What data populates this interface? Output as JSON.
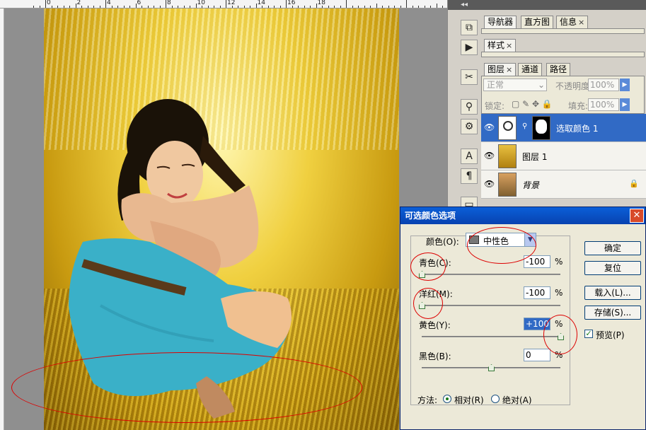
{
  "ruler": {
    "labels": [
      "0",
      "2",
      "4",
      "6",
      "8",
      "10",
      "12",
      "14",
      "16",
      "18"
    ]
  },
  "panels": {
    "tabs_row1": [
      {
        "label": "导航器",
        "close": ""
      },
      {
        "label": "直方图",
        "close": ""
      },
      {
        "label": "信息",
        "close": "×"
      }
    ],
    "tabs_row2": [
      {
        "label": "样式",
        "close": "×"
      }
    ],
    "tabs_row3": [
      {
        "label": "图层",
        "close": "×"
      },
      {
        "label": "通道",
        "close": ""
      },
      {
        "label": "路径",
        "close": ""
      }
    ],
    "blend_mode": "正常",
    "opacity_label": "不透明度:",
    "opacity_value": "100%",
    "lock_label": "锁定:",
    "fill_label": "填充:",
    "fill_value": "100%",
    "layers": [
      {
        "name": "选取颜色 1",
        "selected": true
      },
      {
        "name": "图层 1",
        "selected": false
      },
      {
        "name": "背景",
        "selected": false
      }
    ]
  },
  "dialog": {
    "title": "可选颜色选项",
    "color_label": "颜色(O):",
    "color_value": "中性色",
    "sliders": [
      {
        "label": "青色(C):",
        "value": "-100",
        "level": -100
      },
      {
        "label": "洋红(M):",
        "value": "-100",
        "level": -100
      },
      {
        "label": "黄色(Y):",
        "value": "+100",
        "level": 100
      },
      {
        "label": "黑色(B):",
        "value": "0",
        "level": 0
      }
    ],
    "percent": "%",
    "buttons": {
      "ok": "确定",
      "reset": "复位",
      "load": "载入(L)...",
      "save": "存储(S)..."
    },
    "preview_label": "预览(P)",
    "preview_checked": true,
    "method_label": "方法:",
    "method_options": [
      "相对(R)",
      "绝对(A)"
    ],
    "method_selected": "相对(R)"
  }
}
